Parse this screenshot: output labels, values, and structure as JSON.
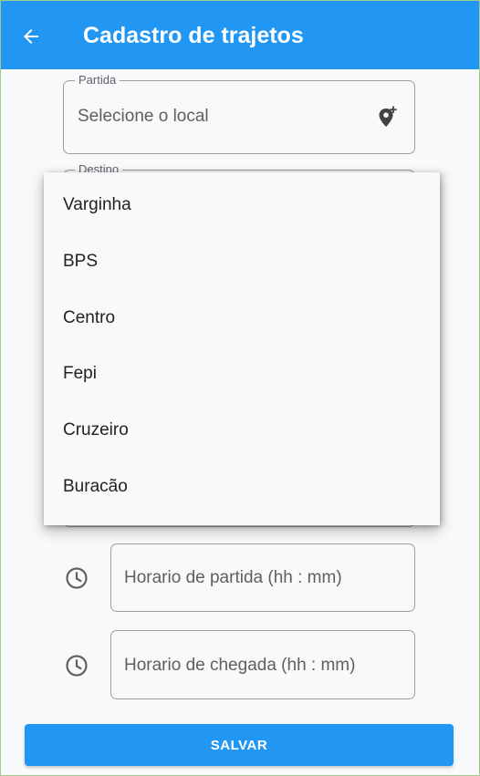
{
  "appbar": {
    "title": "Cadastro de trajetos",
    "back_icon": "arrow-left-icon"
  },
  "partida": {
    "label": "Partida",
    "placeholder": "Selecione o local",
    "icon": "add-location-icon"
  },
  "destino": {
    "label": "Destino"
  },
  "dropdown": {
    "items": [
      "Varginha",
      "BPS",
      "Centro",
      "Fepi",
      "Cruzeiro",
      "Buracão"
    ]
  },
  "horario_partida": {
    "placeholder": "Horario de partida (hh : mm)",
    "icon": "clock-icon"
  },
  "horario_chegada": {
    "placeholder": "Horario de chegada (hh : mm)",
    "icon": "clock-icon"
  },
  "save_button": {
    "label": "SALVAR"
  },
  "colors": {
    "primary": "#2196f3",
    "background": "#f8f9fb"
  }
}
